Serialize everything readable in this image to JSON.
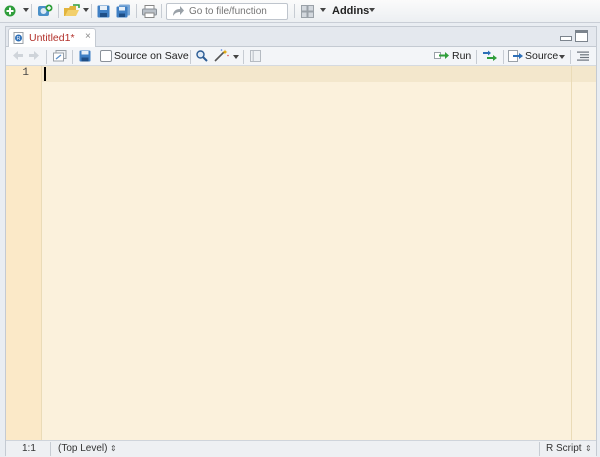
{
  "toolbar": {
    "goto_placeholder": "Go to file/function",
    "addins_label": "Addins"
  },
  "tab": {
    "title": "Untitled1*",
    "close": "×"
  },
  "editor_toolbar": {
    "source_on_save_label": "Source on Save",
    "source_on_save_checked": false,
    "run_label": "Run",
    "source_label": "Source"
  },
  "editor": {
    "line_numbers": [
      "1"
    ],
    "content": ""
  },
  "status": {
    "position": "1:1",
    "scope": "(Top Level)",
    "file_type": "R Script"
  },
  "colors": {
    "editor_bg": "#fbf1dc",
    "gutter_bg": "#fbe9c8",
    "tab_title": "#b2302a"
  }
}
